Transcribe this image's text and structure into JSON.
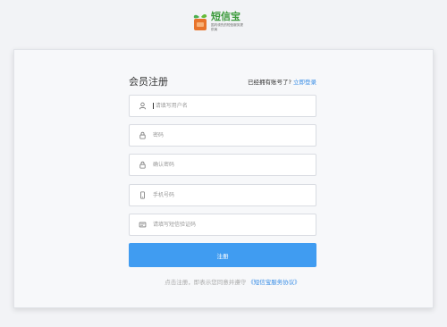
{
  "logo": {
    "title": "短信宝",
    "slogan": "国内领先的短信服务提供商"
  },
  "form": {
    "title": "会员注册",
    "login_question": "已经拥有账号了?",
    "login_link": "立即登录",
    "fields": [
      {
        "icon": "user-icon",
        "placeholder": "请填写用户名"
      },
      {
        "icon": "lock-icon",
        "placeholder": "密码"
      },
      {
        "icon": "lock-icon",
        "placeholder": "确认密码"
      },
      {
        "icon": "phone-icon",
        "placeholder": "手机号码"
      },
      {
        "icon": "sms-code-icon",
        "placeholder": "请填写短信验证码"
      }
    ],
    "register_label": "注册",
    "agreement_text": "点击注册，即表示您同意并遵守",
    "agreement_link": "《短信宝服务协议》"
  },
  "colors": {
    "accent": "#409cf1",
    "link": "#3a8ee6",
    "logo_green": "#3a9a3a",
    "logo_orange": "#e8742c"
  }
}
